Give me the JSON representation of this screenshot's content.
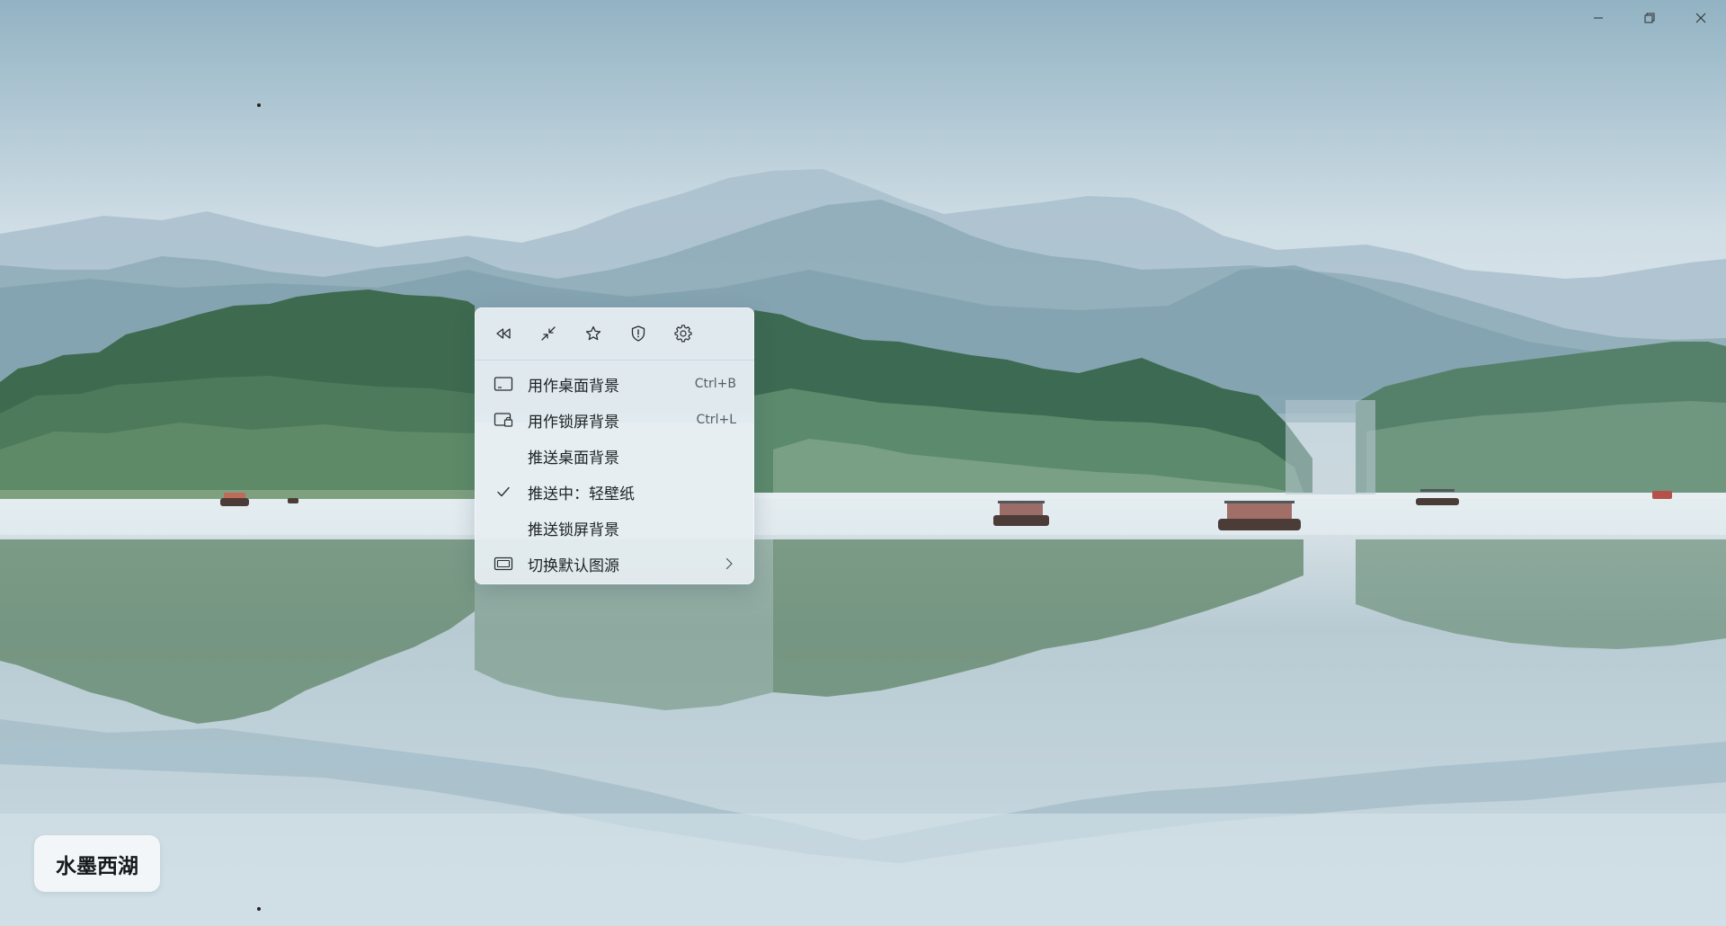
{
  "window": {
    "controls": [
      "minimize-icon",
      "restore-icon",
      "close-icon"
    ]
  },
  "menu": {
    "toolbar": [
      "rewind-icon",
      "collapse-icon",
      "star-icon",
      "shield-icon",
      "gear-icon"
    ],
    "items": [
      {
        "label": "用作桌面背景",
        "shortcut": "Ctrl+B",
        "icon": "monitor-icon"
      },
      {
        "label": "用作锁屏背景",
        "shortcut": "Ctrl+L",
        "icon": "lock-screen-icon"
      },
      {
        "label": "推送桌面背景"
      },
      {
        "label": "推送中：轻壁纸",
        "checked": true,
        "icon": "check-icon"
      },
      {
        "label": "推送锁屏背景"
      },
      {
        "label": "切换默认图源",
        "submenu": true,
        "icon": "gallery-icon"
      }
    ]
  },
  "wallpaper": {
    "title": "水墨西湖"
  }
}
